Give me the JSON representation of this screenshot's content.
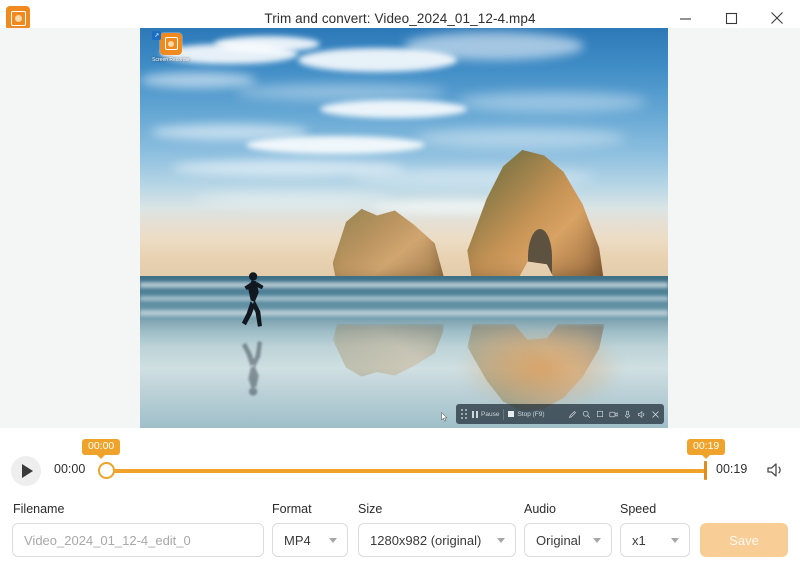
{
  "window": {
    "title": "Trim and convert: Video_2024_01_12-4.mp4",
    "app_icon": "recorder-app-icon",
    "controls": {
      "minimize": "minimize-icon",
      "maximize": "maximize-icon",
      "close": "close-icon"
    }
  },
  "preview": {
    "description": "Screen recording preview of Windows desktop wallpaper",
    "desktop_shortcut_label": "Screen\nRecorder",
    "recorder_toolbar": {
      "grip": "drag-grip-icon",
      "pause_label": "Pause",
      "stop_label": "Stop (F9)",
      "icons": [
        "pen-icon",
        "magnifier-icon",
        "square-icon",
        "webcam-icon",
        "microphone-icon",
        "speaker-icon",
        "close-icon"
      ]
    }
  },
  "timeline": {
    "play_button": "play-icon",
    "start_time": "00:00",
    "end_time": "00:19",
    "start_badge": "00:00",
    "end_badge": "00:19",
    "volume_icon": "volume-icon",
    "accent_color": "#f0a32a"
  },
  "form": {
    "filename": {
      "label": "Filename",
      "placeholder": "Video_2024_01_12-4_edit_0",
      "value": ""
    },
    "format": {
      "label": "Format",
      "value": "MP4"
    },
    "size": {
      "label": "Size",
      "value": "1280x982 (original)"
    },
    "audio": {
      "label": "Audio",
      "value": "Original"
    },
    "speed": {
      "label": "Speed",
      "value": "x1"
    },
    "save_label": "Save"
  }
}
